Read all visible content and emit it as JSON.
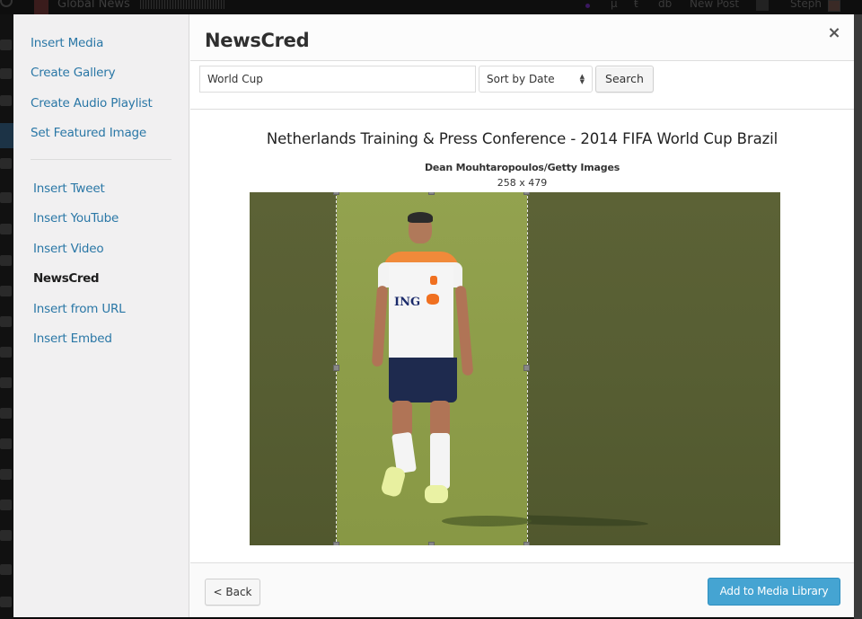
{
  "admin_bar": {
    "site_name": "Global News",
    "mu": "µ",
    "tee": "ŧ",
    "db": "db",
    "new_post": "New Post",
    "user": "Steph"
  },
  "modal": {
    "title": "NewsCred",
    "close_icon": "×",
    "menu": {
      "group1": [
        {
          "label": "Insert Media"
        },
        {
          "label": "Create Gallery"
        },
        {
          "label": "Create Audio Playlist"
        },
        {
          "label": "Set Featured Image"
        }
      ],
      "group2": [
        {
          "label": "Insert Tweet"
        },
        {
          "label": "Insert YouTube"
        },
        {
          "label": "Insert Video"
        },
        {
          "label": "NewsCred",
          "active": true
        },
        {
          "label": "Insert from URL"
        },
        {
          "label": "Insert Embed"
        }
      ]
    },
    "toolbar": {
      "search_value": "World Cup",
      "sort_selected": "Sort by Date",
      "sort_arrows": "▲▼",
      "search_button": "Search"
    },
    "image": {
      "title": "Netherlands Training & Press Conference - 2014 FIFA World Cup Brazil",
      "credit": "Dean Mouhtaropoulos/Getty Images",
      "dimensions": "258 x 479",
      "shirt_sponsor": "ING"
    },
    "footer": {
      "back_button": "< Back",
      "add_button": "Add to Media Library"
    }
  },
  "colors": {
    "link": "#2a77a6",
    "primary_button": "#45a4d2",
    "menu_bg": "#f1f0f1"
  }
}
